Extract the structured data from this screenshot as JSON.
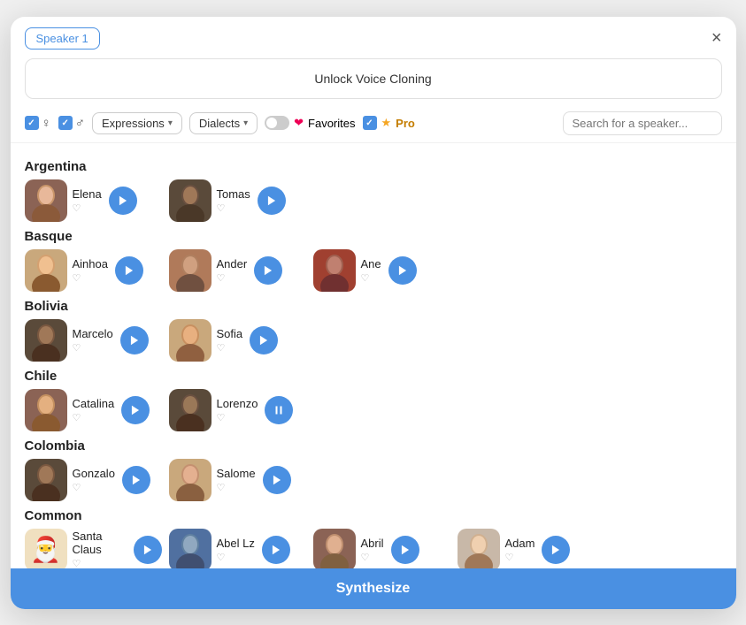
{
  "modal": {
    "speaker_badge": "Speaker 1",
    "close_icon": "×",
    "unlock_banner": "Unlock Voice Cloning"
  },
  "filters": {
    "expressions_label": "Expressions",
    "dialects_label": "Dialects",
    "favorites_label": "Favorites",
    "pro_label": "Pro",
    "search_placeholder": "Search for a speaker..."
  },
  "regions": [
    {
      "name": "Argentina",
      "speakers": [
        {
          "name": "Elena",
          "playing": false
        },
        {
          "name": "Tomas",
          "playing": false
        }
      ]
    },
    {
      "name": "Basque",
      "speakers": [
        {
          "name": "Ainhoa",
          "playing": false
        },
        {
          "name": "Ander",
          "playing": false
        },
        {
          "name": "Ane",
          "playing": false
        }
      ]
    },
    {
      "name": "Bolivia",
      "speakers": [
        {
          "name": "Marcelo",
          "playing": false
        },
        {
          "name": "Sofia",
          "playing": false
        }
      ]
    },
    {
      "name": "Chile",
      "speakers": [
        {
          "name": "Catalina",
          "playing": false
        },
        {
          "name": "Lorenzo",
          "playing": true
        }
      ]
    },
    {
      "name": "Colombia",
      "speakers": [
        {
          "name": "Gonzalo",
          "playing": false
        },
        {
          "name": "Salome",
          "playing": false
        }
      ]
    },
    {
      "name": "Common",
      "speakers": [
        {
          "name": "Santa Claus",
          "playing": false,
          "emoji": "🎅"
        },
        {
          "name": "Abel Lz",
          "playing": false
        },
        {
          "name": "Abril",
          "playing": false
        },
        {
          "name": "Adam",
          "playing": false
        }
      ]
    }
  ],
  "synth_button": "Synthesize"
}
